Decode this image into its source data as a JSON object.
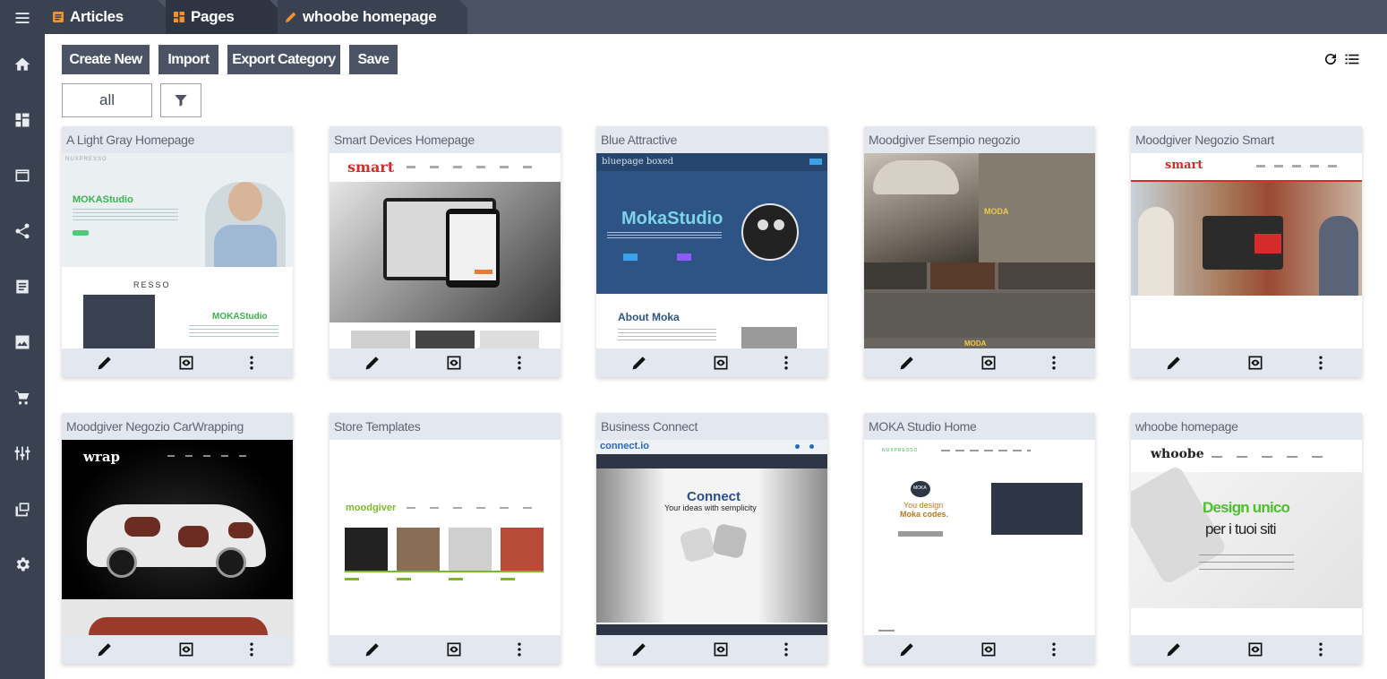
{
  "tabs": [
    {
      "label": "Articles",
      "icon": "article-icon"
    },
    {
      "label": "Pages",
      "icon": "pages-icon"
    },
    {
      "label": "whoobe homepage",
      "icon": "pencil-icon"
    }
  ],
  "sidebar": [
    {
      "icon": "menu-icon"
    },
    {
      "icon": "home-icon"
    },
    {
      "icon": "dashboard-icon"
    },
    {
      "icon": "browser-window-icon"
    },
    {
      "icon": "share-icon"
    },
    {
      "icon": "article-icon"
    },
    {
      "icon": "image-icon"
    },
    {
      "icon": "cart-icon"
    },
    {
      "icon": "sliders-icon"
    },
    {
      "icon": "stack-icon"
    },
    {
      "icon": "gear-icon"
    }
  ],
  "toolbar": {
    "create_new": "Create New",
    "import": "Import",
    "export_category": "Export Category",
    "save": "Save",
    "filter_value": "all"
  },
  "colors": {
    "sidebar": "#3a4150",
    "topbar": "#4b5364",
    "button": "#4b5364",
    "card_header": "#e3e8f0",
    "tab_icon_accent": "#f0922e"
  },
  "cards": [
    {
      "title": "A Light Gray Homepage",
      "thumb": {
        "logo": "NUXPRESSO",
        "heading": "MOKAStudio",
        "heading2": "MOKAStudio",
        "brand": "RESSO"
      }
    },
    {
      "title": "Smart Devices Homepage",
      "thumb": {
        "logo": "smart"
      }
    },
    {
      "title": "Blue Attractive",
      "thumb": {
        "logo": "bluepage boxed",
        "heading": "MokaStudio",
        "subheading": "About Moka"
      }
    },
    {
      "title": "Moodgiver Esempio negozio",
      "thumb": {
        "heading": "MODA",
        "heading2": "MODA"
      }
    },
    {
      "title": "Moodgiver Negozio Smart",
      "thumb": {
        "logo": "smart"
      }
    },
    {
      "title": "Moodgiver Negozio CarWrapping",
      "thumb": {
        "logo": "wrap"
      }
    },
    {
      "title": "Store Templates",
      "thumb": {
        "logo": "moodgiver"
      }
    },
    {
      "title": "Business Connect",
      "thumb": {
        "logo": "connect.io",
        "heading": "Connect",
        "subheading": "Your ideas with semplicity"
      }
    },
    {
      "title": "MOKA Studio Home",
      "thumb": {
        "logo": "NUXPRESSO",
        "badge": "MOKA",
        "heading": "You design",
        "heading2": "Moka codes."
      }
    },
    {
      "title": "whoobe homepage",
      "thumb": {
        "logo": "whoobe",
        "heading": "Design unico",
        "heading2": "per i tuoi siti"
      }
    }
  ]
}
